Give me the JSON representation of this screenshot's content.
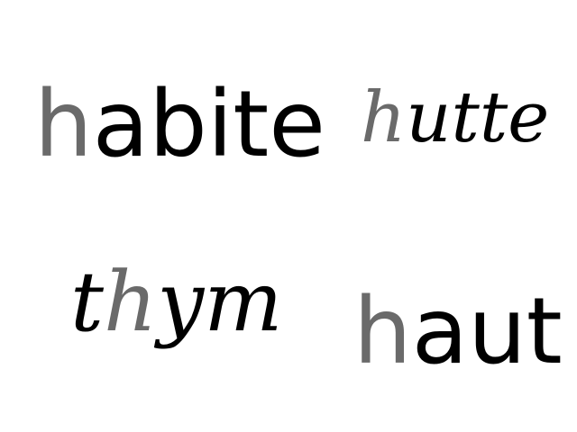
{
  "words": [
    {
      "id": "habite",
      "style": "print",
      "highlight": "h",
      "rest": "abite"
    },
    {
      "id": "hutte",
      "style": "cursive",
      "highlight": "h",
      "rest": "utte"
    },
    {
      "id": "thym",
      "style": "cursive",
      "prefix": "t",
      "highlight": "h",
      "rest": "ym"
    },
    {
      "id": "haut",
      "style": "print",
      "highlight": "h",
      "rest": "aut"
    }
  ],
  "colors": {
    "text": "#000000",
    "highlight": "#6a6a6a",
    "background": "#ffffff"
  }
}
